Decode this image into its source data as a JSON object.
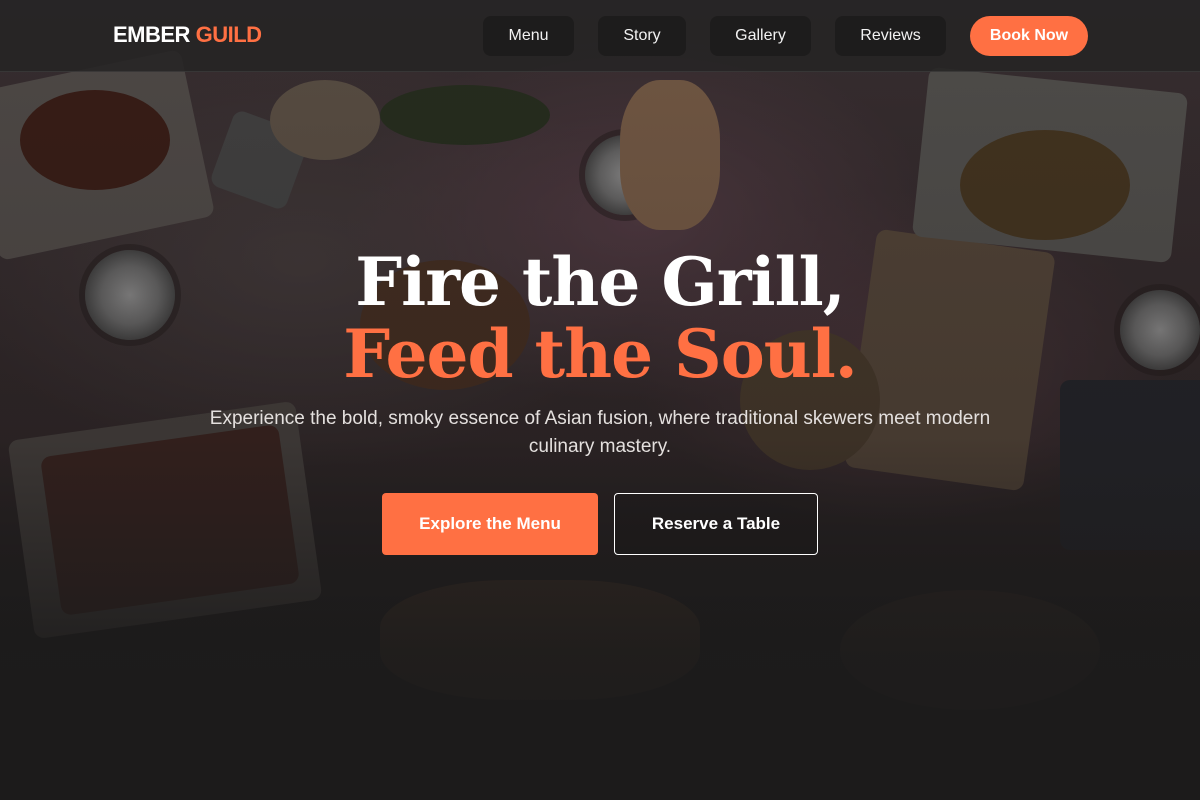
{
  "brand": {
    "name_part1": "EMBER",
    "name_part2": "GUILD",
    "accent_color": "#ff7043"
  },
  "nav": {
    "links": [
      {
        "label": "Menu"
      },
      {
        "label": "Story"
      },
      {
        "label": "Gallery"
      },
      {
        "label": "Reviews"
      }
    ],
    "cta_label": "Book Now"
  },
  "hero": {
    "headline_line1": "Fire the Grill,",
    "headline_line2": "Feed the Soul.",
    "subtitle": "Experience the bold, smoky essence of Asian fusion, where traditional skewers meet modern culinary mastery.",
    "primary_cta": "Explore the Menu",
    "secondary_cta": "Reserve a Table",
    "background_image": "overhead-food-spread-photo"
  },
  "colors": {
    "background": "#1c1b1b",
    "nav_bg": "#262424",
    "accent": "#ff7043",
    "text": "#ffffff"
  }
}
